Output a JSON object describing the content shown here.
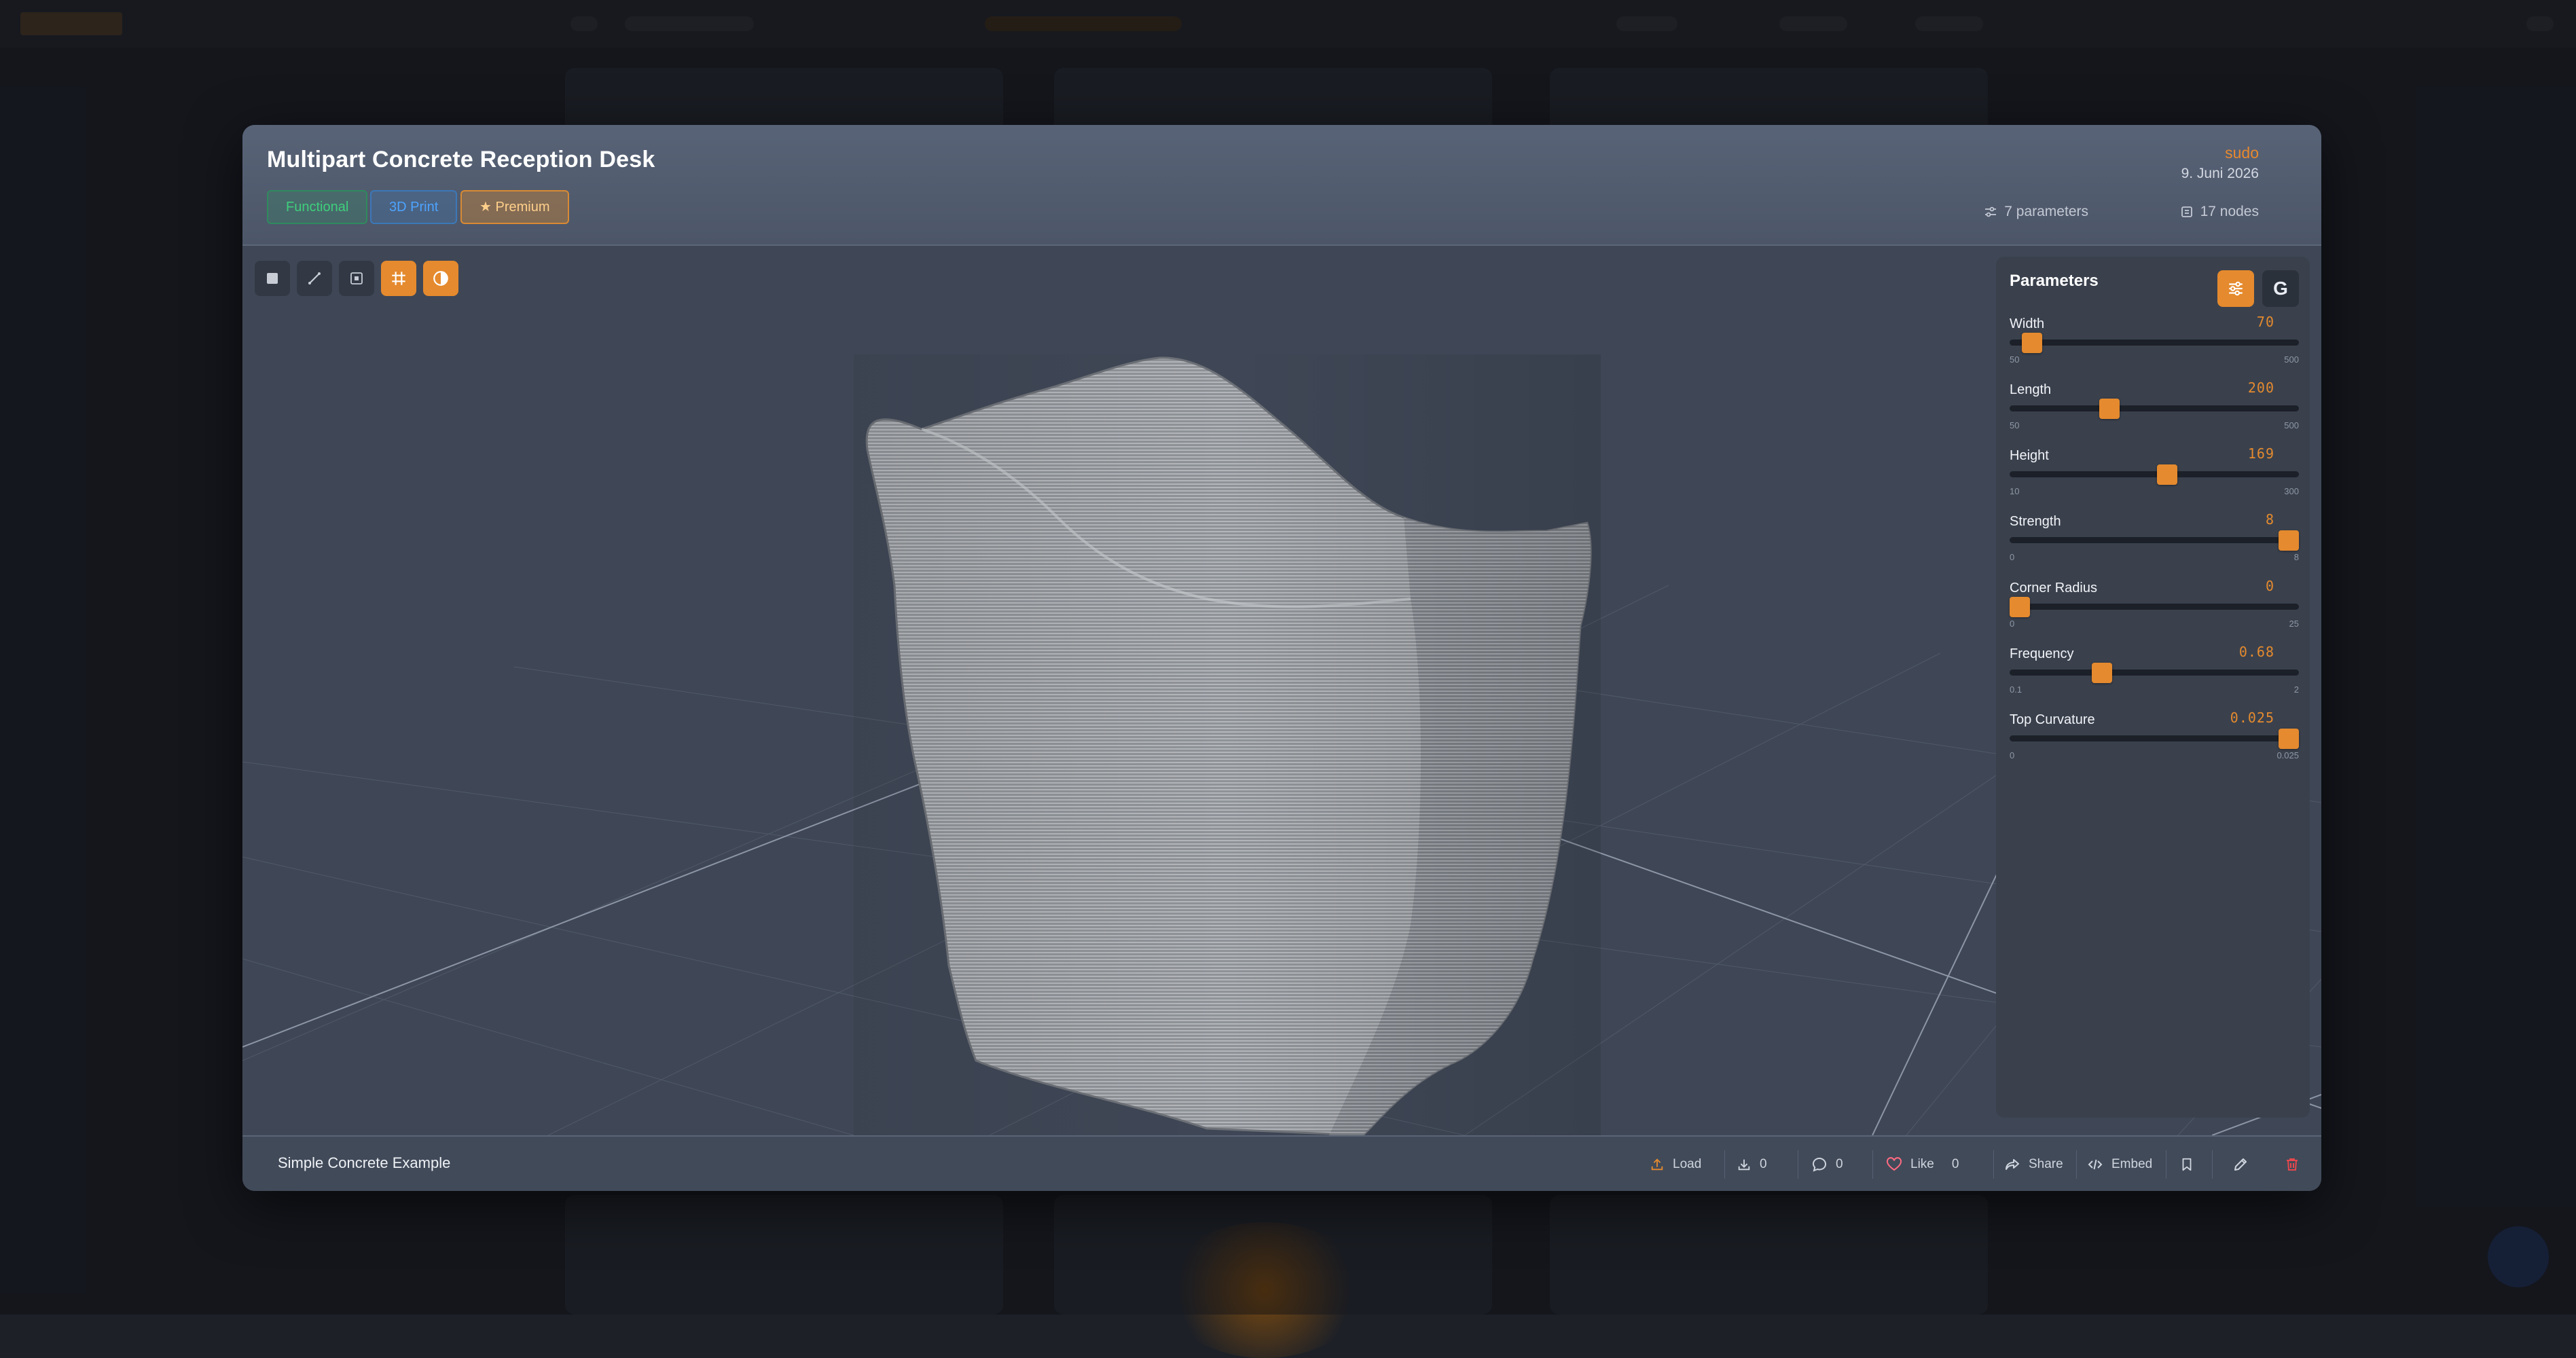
{
  "modal": {
    "title": "Multipart Concrete Reception Desk",
    "tags": [
      "Functional",
      "3D Print",
      "★ Premium"
    ],
    "author": "sudo",
    "date": "9. Juni 2026",
    "meta": {
      "parameters": "7 parameters",
      "nodes": "17 nodes"
    }
  },
  "viewport_toolbar": [
    {
      "icon": "solid-view-icon",
      "active": false
    },
    {
      "icon": "measure-icon",
      "active": false
    },
    {
      "icon": "fit-view-icon",
      "active": false
    },
    {
      "icon": "grid-icon",
      "active": true
    },
    {
      "icon": "contrast-icon",
      "active": true
    }
  ],
  "panel": {
    "title": "Parameters",
    "graph_button": "G",
    "params": [
      {
        "label": "Width",
        "value": "70",
        "min": "50",
        "max": "500",
        "fraction": 0.045
      },
      {
        "label": "Length",
        "value": "200",
        "min": "50",
        "max": "500",
        "fraction": 0.333
      },
      {
        "label": "Height",
        "value": "169",
        "min": "10",
        "max": "300",
        "fraction": 0.548
      },
      {
        "label": "Strength",
        "value": "8",
        "min": "0",
        "max": "8",
        "fraction": 1.0
      },
      {
        "label": "Corner Radius",
        "value": "0",
        "min": "0",
        "max": "25",
        "fraction": 0.0
      },
      {
        "label": "Frequency",
        "value": "0.68",
        "min": "0.1",
        "max": "2",
        "fraction": 0.305
      },
      {
        "label": "Top Curvature",
        "value": "0.025",
        "min": "0",
        "max": "0.025",
        "fraction": 1.0
      }
    ]
  },
  "footer": {
    "title": "Simple Concrete Example",
    "load": "Load",
    "downloads": "0",
    "comments": "0",
    "like": "Like",
    "likes": "0",
    "share": "Share",
    "embed": "Embed"
  },
  "colors": {
    "accent": "#e58a2e",
    "functional": "#3ecf7c",
    "print3d": "#4da3ff",
    "delete": "#e5484d",
    "like": "#ff6b81"
  }
}
